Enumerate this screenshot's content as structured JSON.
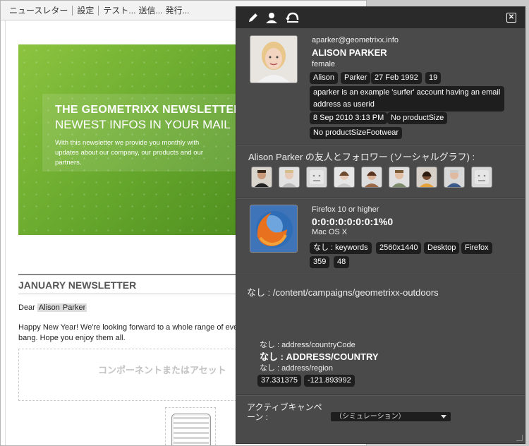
{
  "topbar": {
    "items": [
      "ニュースレター",
      "設定",
      "テスト...",
      "送信...",
      "発行..."
    ]
  },
  "newsletter": {
    "banner_title": "THE GEOMETRIXX NEWSLETTER",
    "banner_subtitle": "NEWEST INFOS IN YOUR MAIL",
    "banner_text": "With this newsletter we provide you monthly with updates about our company, our products and our partners.",
    "heading": "JANUARY NEWSLETTER",
    "dear": "Dear",
    "first_name": "Alison",
    "last_name": "Parker",
    "body": "Happy New Year! We're looking forward to a whole range of eve\nbang. Hope you enjoy them all.",
    "dropzone_text": "コンポーネントまたはアセット"
  },
  "hub": {
    "profile": {
      "email": "aparker@geometrixx.info",
      "name": "ALISON PARKER",
      "gender": "female",
      "tags": [
        "Alison",
        "Parker",
        "27 Feb 1992",
        "19"
      ],
      "description": "aparker is an example 'surfer' account having an email address as userid",
      "date": "8 Sep 2010 3:13 PM",
      "product_size": "No productSize",
      "product_size_footwear": "No productSizeFootwear"
    },
    "friends_label": "Alison Parker の友人とフォロワー (ソーシャルグラフ) :",
    "browser": {
      "name": "Firefox 10 or higher",
      "ip": "0:0:0:0:0:0:0:1%0",
      "os": "Mac OS X",
      "tags_row1": [
        "なし : keywords",
        "2560x1440",
        "Desktop",
        "Firefox"
      ],
      "tags_row2": [
        "359",
        "48"
      ]
    },
    "path": "なし : /content/campaigns/geometrixx-outdoors",
    "geo": {
      "country_code": "なし : address/countryCode",
      "country": "なし : ADDRESS/COUNTRY",
      "region": "なし : address/region",
      "lat": "37.331375",
      "lng": "-121.893992"
    },
    "campaign_label": "アクティブキャンペーン :",
    "campaign_select": "（シミュレーション）"
  }
}
